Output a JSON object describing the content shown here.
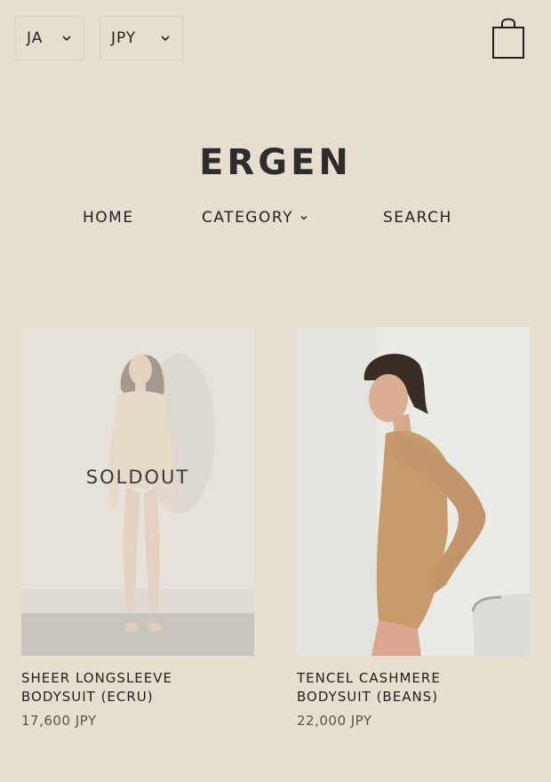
{
  "header": {
    "language": "JA",
    "currency": "JPY",
    "cart_icon": "shopping-bag-icon"
  },
  "logo": "ERGEN",
  "nav": {
    "home": "HOME",
    "category": "CATEGORY",
    "search": "SEARCH"
  },
  "products": [
    {
      "title_line1": "SHEER LONGSLEEVE",
      "title_line2": "BODYSUIT (ECRU)",
      "price": "17,600 JPY",
      "badge": "SOLDOUT"
    },
    {
      "title_line1": "TENCEL CASHMERE",
      "title_line2": "BODYSUIT (BEANS)",
      "price": "22,000 JPY"
    }
  ],
  "colors": {
    "background": "#e6dfcf",
    "text": "#222222"
  }
}
